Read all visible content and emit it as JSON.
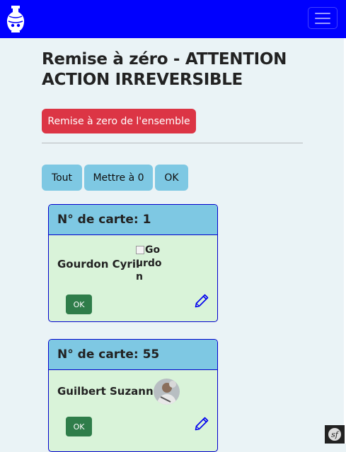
{
  "nav": {
    "logo_icon": "vase-logo-icon",
    "menu_icon": "hamburger-icon"
  },
  "page": {
    "title": "Remise à zéro - ATTENTION ACTION IRREVERSIBLE",
    "reset_all_label": "Remise à zero de l'ensemble",
    "filters": [
      "Tout",
      "Mettre à 0",
      "OK"
    ]
  },
  "cards": [
    {
      "header": "N° de carte: 1",
      "name": "Gourdon Cyril",
      "image_alt": "Gourdon",
      "ok_label": "OK",
      "edit_icon": "pencil-icon"
    },
    {
      "header": "N° de carte: 55",
      "name": "Guilbert Suzanne",
      "image_alt": "",
      "ok_label": "OK",
      "edit_icon": "pencil-icon"
    }
  ],
  "colors": {
    "navbar": "#0000fe",
    "danger": "#dc3545",
    "filter_button": "#7ec8e3",
    "card_body": "#d9f3d9",
    "ok_button": "#2f7d4a"
  },
  "debug_toolbar": {
    "icon": "symfony-icon",
    "glyph": "sf"
  }
}
